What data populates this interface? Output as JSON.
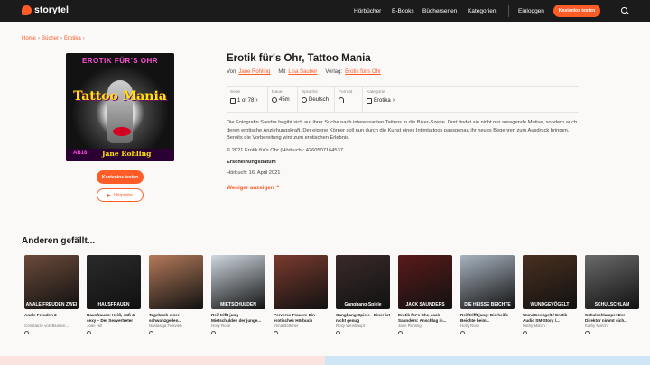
{
  "brand": {
    "name": "storytel",
    "accent": "#ff5c28"
  },
  "nav": {
    "items": [
      "Hörbücher",
      "E-Books",
      "Bücherserien",
      "Kategorien"
    ],
    "login": "Einloggen",
    "cta": "Kostenlos testen"
  },
  "breadcrumb": [
    "Home",
    "Bücher",
    "Erotika"
  ],
  "cover": {
    "top_text": "EROTIK FÜR'S OHR",
    "title": "Tattoo Mania",
    "age": "AB18",
    "author": "Jane Rohling"
  },
  "book": {
    "title": "Erotik für's Ohr, Tattoo Mania",
    "by_label": "Von",
    "author": "Jane Rohling",
    "with_label": "Mit",
    "narrator": "Lisa Sauber",
    "publisher_label": "Verlag:",
    "publisher": "Erotik für's Ohr"
  },
  "meta": [
    {
      "label": "Serie",
      "value": "1 of 78",
      "icon": "series-icon"
    },
    {
      "label": "Dauer",
      "value": "45m",
      "icon": "clock-icon"
    },
    {
      "label": "Sprache",
      "value": "Deutsch",
      "icon": "globe-icon"
    },
    {
      "label": "Format",
      "value": "",
      "icon": "headphones-icon"
    },
    {
      "label": "Kategorie",
      "value": "Erotika",
      "icon": "category-icon"
    }
  ],
  "description": "Die Fotografin Sandra begibt sich auf ihrer Suche nach interessanten Tattoos in die Biker-Szene. Dort findet sie nicht nur anregende Motive, sondern auch deren erotische Anziehungskraft. Der eigene Körper soll nun durch die Kunst eines Intimtattoos passgenau ihr neues Begehren zum Ausdruck bringen. Bereits die Vorbereitung wird zum erotischen Erlebnis.",
  "copyright": "© 2021 Erotik für's Ohr (Hörbuch): 4260507164537",
  "pub_heading": "Erscheinungsdatum",
  "pub_date": "Hörbuch: 16. April 2021",
  "show_less": "Weniger anzeigen",
  "buttons": {
    "trial": "Kostenlos testen",
    "sample": "Hörprobe"
  },
  "section_title": "Anderen gefällt...",
  "recommendations": [
    {
      "title": "Anale Freuden 2",
      "author": "Constanze von Blumen...",
      "caption": "ANALE FREUDEN ZWEI",
      "color": "#6b4a3a"
    },
    {
      "title": "Hausfrauen: Heiß, süß & sexy – Der Sexvertreter",
      "author": "Joan Hill",
      "caption": "HAUSFRAUEN",
      "color": "#2a2a2a"
    },
    {
      "title": "Tagebuch einer schwanzgeilen...",
      "author": "Nastassja Fickvieh",
      "caption": "",
      "color": "#b47a5a"
    },
    {
      "title": "Reif trifft jung - Mietschulden der junge...",
      "author": "Holly Rose",
      "caption": "MIETSCHULDEN",
      "color": "#cfd8e0"
    },
    {
      "title": "Perverse Frauen: Ein erotisches Hörbuch",
      "author": "Irena Böttcher",
      "caption": "",
      "color": "#7a3b2e"
    },
    {
      "title": "Gangbang-Spiele - Einer ist nicht genug",
      "author": "Roxy Weishaupt",
      "caption": "Gangbang-Spiele",
      "color": "#3a2a2a"
    },
    {
      "title": "Erotik für's Ohr, Jack Saunders: Anschlag in...",
      "author": "Jane Rohling",
      "caption": "JACK SAUNDERS",
      "color": "#5a1a1a"
    },
    {
      "title": "Reif trifft jung: Die heiße Beichte beim...",
      "author": "Holly Rose",
      "caption": "DIE HEISSE BEICHTE",
      "color": "#a8b4c0"
    },
    {
      "title": "WundGevögelt / Erotik Audio SM-Story /...",
      "author": "Kathy March",
      "caption": "WUNDGEVÖGELT",
      "color": "#4a3020"
    },
    {
      "title": "Schulschlampe: Der Direktor nimmt sich...",
      "author": "Kathy March",
      "caption": "SCHULSCHLAM",
      "color": "#6a6a6a"
    }
  ]
}
